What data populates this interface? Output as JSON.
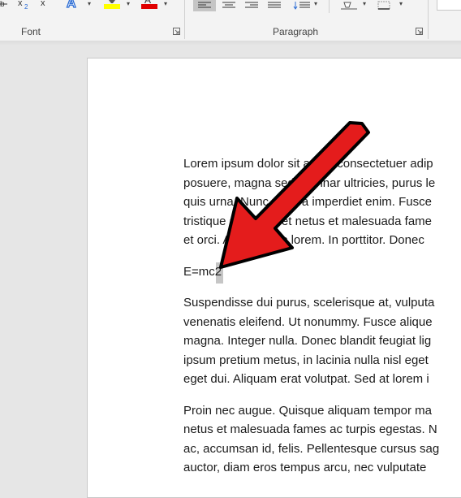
{
  "ribbon": {
    "groups": {
      "font_label": "Font",
      "paragraph_label": "Paragraph"
    },
    "colors": {
      "highlight": "#ffff00",
      "font_color": "#e00000",
      "text_effects": "#2b6cd4"
    },
    "icons": [
      "strikethrough-icon",
      "subscript-icon",
      "superscript-icon",
      "text-effects-icon",
      "highlight-color-icon",
      "font-color-icon",
      "align-left-icon",
      "align-center-icon",
      "align-right-icon",
      "justify-icon",
      "line-spacing-icon",
      "shading-icon",
      "borders-icon"
    ]
  },
  "document": {
    "paragraph1": [
      "Lorem ipsum dolor sit amet, consectetuer adip",
      "posuere, magna sed pulvinar ultricies, purus le",
      "quis urna. Nunc viverra imperdiet enim. Fusce",
      "tristique senectus et netus et malesuada fame",
      "et orci. Aenean nec lorem. In porttitor. Donec"
    ],
    "equation": "E=mc2",
    "paragraph2": [
      "Suspendisse dui purus, scelerisque at, vulputa",
      "venenatis eleifend. Ut nonummy. Fusce alique",
      "magna. Integer nulla. Donec blandit feugiat lig",
      "ipsum pretium metus, in lacinia nulla nisl eget",
      "eget dui. Aliquam erat volutpat. Sed at lorem i"
    ],
    "paragraph3": [
      "Proin nec augue. Quisque aliquam tempor ma",
      "netus et malesuada fames ac turpis egestas. N",
      "ac, accumsan id, felis. Pellentesque cursus sag",
      "auctor, diam eros tempus arcu, nec vulputate"
    ]
  },
  "annotation": {
    "arrow_color": "#e41c1c"
  }
}
